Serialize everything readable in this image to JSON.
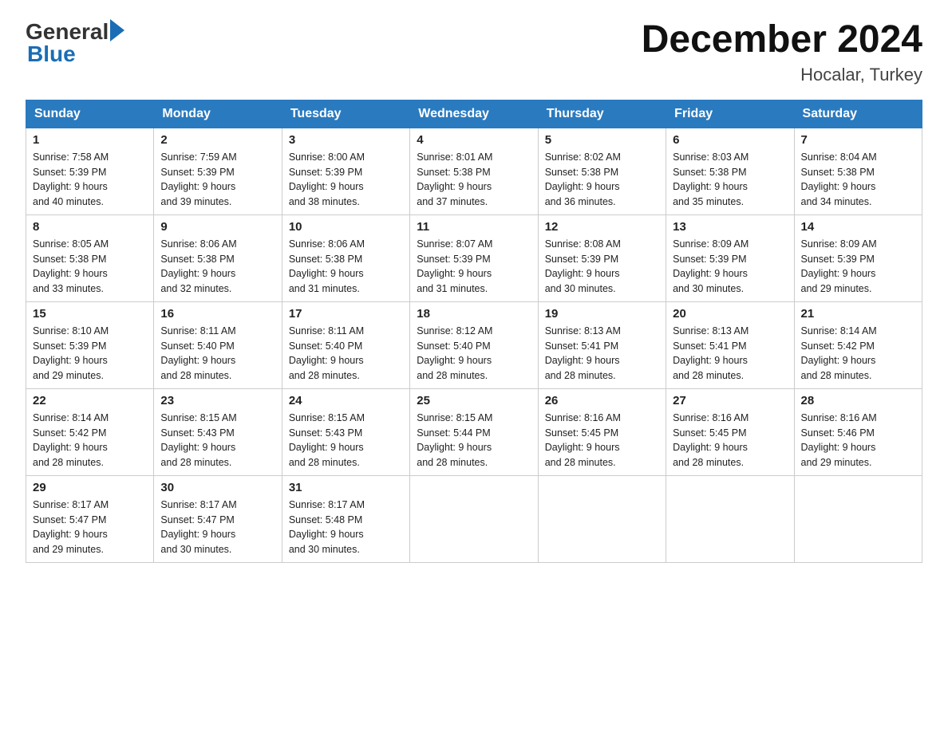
{
  "header": {
    "logo_general": "General",
    "logo_blue": "Blue",
    "title": "December 2024",
    "subtitle": "Hocalar, Turkey"
  },
  "days_of_week": [
    "Sunday",
    "Monday",
    "Tuesday",
    "Wednesday",
    "Thursday",
    "Friday",
    "Saturday"
  ],
  "weeks": [
    [
      {
        "day": "1",
        "sunrise": "7:58 AM",
        "sunset": "5:39 PM",
        "daylight": "9 hours and 40 minutes."
      },
      {
        "day": "2",
        "sunrise": "7:59 AM",
        "sunset": "5:39 PM",
        "daylight": "9 hours and 39 minutes."
      },
      {
        "day": "3",
        "sunrise": "8:00 AM",
        "sunset": "5:39 PM",
        "daylight": "9 hours and 38 minutes."
      },
      {
        "day": "4",
        "sunrise": "8:01 AM",
        "sunset": "5:38 PM",
        "daylight": "9 hours and 37 minutes."
      },
      {
        "day": "5",
        "sunrise": "8:02 AM",
        "sunset": "5:38 PM",
        "daylight": "9 hours and 36 minutes."
      },
      {
        "day": "6",
        "sunrise": "8:03 AM",
        "sunset": "5:38 PM",
        "daylight": "9 hours and 35 minutes."
      },
      {
        "day": "7",
        "sunrise": "8:04 AM",
        "sunset": "5:38 PM",
        "daylight": "9 hours and 34 minutes."
      }
    ],
    [
      {
        "day": "8",
        "sunrise": "8:05 AM",
        "sunset": "5:38 PM",
        "daylight": "9 hours and 33 minutes."
      },
      {
        "day": "9",
        "sunrise": "8:06 AM",
        "sunset": "5:38 PM",
        "daylight": "9 hours and 32 minutes."
      },
      {
        "day": "10",
        "sunrise": "8:06 AM",
        "sunset": "5:38 PM",
        "daylight": "9 hours and 31 minutes."
      },
      {
        "day": "11",
        "sunrise": "8:07 AM",
        "sunset": "5:39 PM",
        "daylight": "9 hours and 31 minutes."
      },
      {
        "day": "12",
        "sunrise": "8:08 AM",
        "sunset": "5:39 PM",
        "daylight": "9 hours and 30 minutes."
      },
      {
        "day": "13",
        "sunrise": "8:09 AM",
        "sunset": "5:39 PM",
        "daylight": "9 hours and 30 minutes."
      },
      {
        "day": "14",
        "sunrise": "8:09 AM",
        "sunset": "5:39 PM",
        "daylight": "9 hours and 29 minutes."
      }
    ],
    [
      {
        "day": "15",
        "sunrise": "8:10 AM",
        "sunset": "5:39 PM",
        "daylight": "9 hours and 29 minutes."
      },
      {
        "day": "16",
        "sunrise": "8:11 AM",
        "sunset": "5:40 PM",
        "daylight": "9 hours and 28 minutes."
      },
      {
        "day": "17",
        "sunrise": "8:11 AM",
        "sunset": "5:40 PM",
        "daylight": "9 hours and 28 minutes."
      },
      {
        "day": "18",
        "sunrise": "8:12 AM",
        "sunset": "5:40 PM",
        "daylight": "9 hours and 28 minutes."
      },
      {
        "day": "19",
        "sunrise": "8:13 AM",
        "sunset": "5:41 PM",
        "daylight": "9 hours and 28 minutes."
      },
      {
        "day": "20",
        "sunrise": "8:13 AM",
        "sunset": "5:41 PM",
        "daylight": "9 hours and 28 minutes."
      },
      {
        "day": "21",
        "sunrise": "8:14 AM",
        "sunset": "5:42 PM",
        "daylight": "9 hours and 28 minutes."
      }
    ],
    [
      {
        "day": "22",
        "sunrise": "8:14 AM",
        "sunset": "5:42 PM",
        "daylight": "9 hours and 28 minutes."
      },
      {
        "day": "23",
        "sunrise": "8:15 AM",
        "sunset": "5:43 PM",
        "daylight": "9 hours and 28 minutes."
      },
      {
        "day": "24",
        "sunrise": "8:15 AM",
        "sunset": "5:43 PM",
        "daylight": "9 hours and 28 minutes."
      },
      {
        "day": "25",
        "sunrise": "8:15 AM",
        "sunset": "5:44 PM",
        "daylight": "9 hours and 28 minutes."
      },
      {
        "day": "26",
        "sunrise": "8:16 AM",
        "sunset": "5:45 PM",
        "daylight": "9 hours and 28 minutes."
      },
      {
        "day": "27",
        "sunrise": "8:16 AM",
        "sunset": "5:45 PM",
        "daylight": "9 hours and 28 minutes."
      },
      {
        "day": "28",
        "sunrise": "8:16 AM",
        "sunset": "5:46 PM",
        "daylight": "9 hours and 29 minutes."
      }
    ],
    [
      {
        "day": "29",
        "sunrise": "8:17 AM",
        "sunset": "5:47 PM",
        "daylight": "9 hours and 29 minutes."
      },
      {
        "day": "30",
        "sunrise": "8:17 AM",
        "sunset": "5:47 PM",
        "daylight": "9 hours and 30 minutes."
      },
      {
        "day": "31",
        "sunrise": "8:17 AM",
        "sunset": "5:48 PM",
        "daylight": "9 hours and 30 minutes."
      },
      null,
      null,
      null,
      null
    ]
  ],
  "labels": {
    "sunrise": "Sunrise:",
    "sunset": "Sunset:",
    "daylight": "Daylight:"
  }
}
